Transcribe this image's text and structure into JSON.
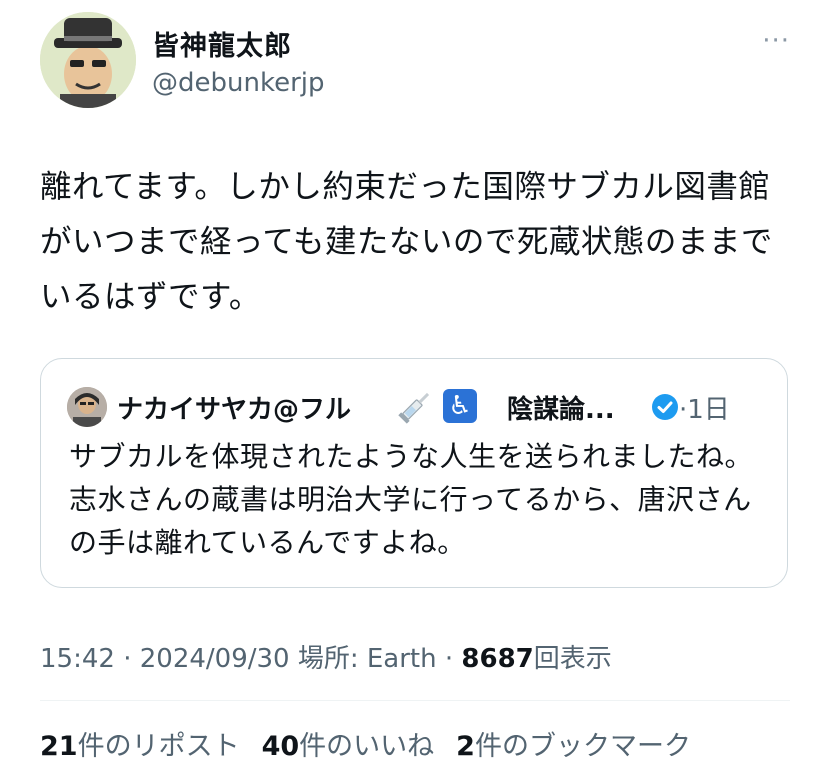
{
  "author": {
    "name": "皆神龍太郎",
    "handle": "@debunkerjp",
    "more": "···"
  },
  "tweet": {
    "text": "離れてます。しかし約束だった国際サブカル図書館がいつまで経っても建たないので死蔵状態のままでいるはずです。"
  },
  "quote": {
    "name": "ナカイサヤカ@フル",
    "access_icon": "♿",
    "bio_label": "陰謀論...",
    "time": "·1日",
    "text": "サブカルを体現されたような人生を送られましたね。志水さんの蔵書は明治大学に行ってるから、唐沢さんの手は離れているんですよね。"
  },
  "meta": {
    "time": "15:42",
    "sep1": " · ",
    "date": "2024/09/30",
    "location": " 場所: Earth",
    "sep2": " · ",
    "views": "8687",
    "views_label": "回表示"
  },
  "stats": {
    "reposts": "21",
    "reposts_label": "件のリポスト",
    "likes": "40",
    "likes_label": "件のいいね",
    "bookmarks": "2",
    "bookmarks_label": "件のブックマーク"
  },
  "colors": {
    "text": "#0f1419",
    "secondary": "#536471",
    "border": "#cfd9de",
    "verified": "#1d9bf0"
  }
}
